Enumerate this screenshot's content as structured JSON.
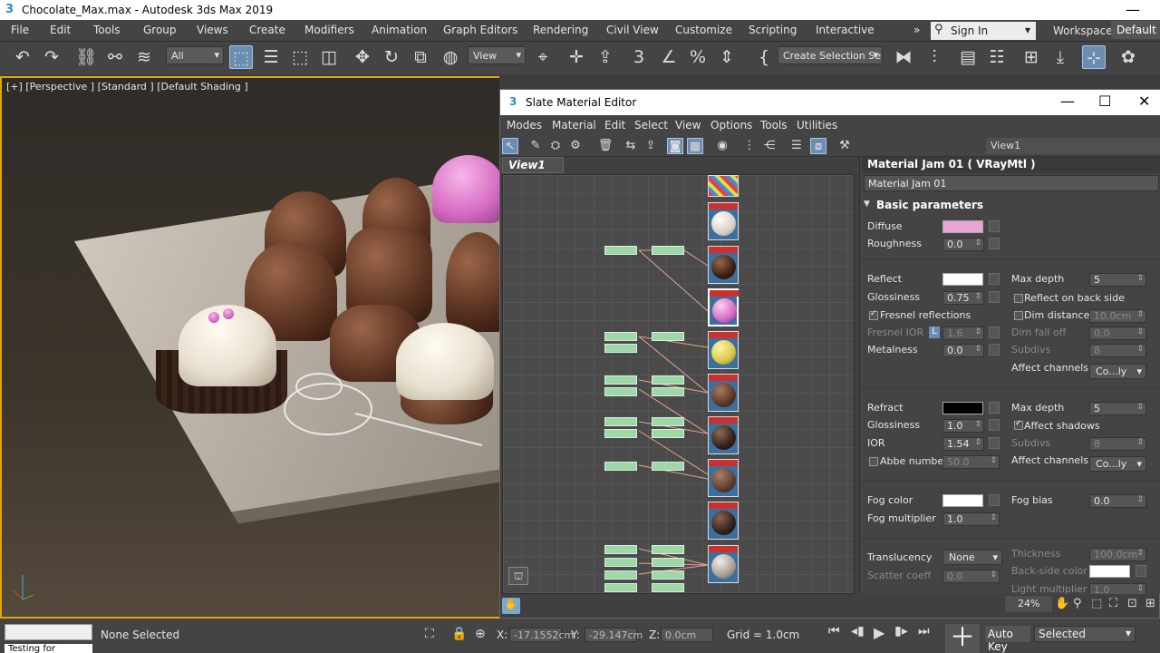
{
  "app": {
    "title": "Chocolate_Max.max - Autodesk 3ds Max 2019",
    "logo_glyph": "3"
  },
  "menu": [
    "File",
    "Edit",
    "Tools",
    "Group",
    "Views",
    "Create",
    "Modifiers",
    "Animation",
    "Graph Editors",
    "Rendering",
    "Civil View",
    "Customize",
    "Scripting",
    "Interactive"
  ],
  "account": {
    "sign_in": "Sign In",
    "workspaces_label": "Workspaces:",
    "workspace": "Default"
  },
  "toolbar": {
    "filter": "All",
    "ref_coord": "View",
    "selection_set": "Create Selection Se"
  },
  "viewport": {
    "label": "[+] [Perspective ] [Standard ] [Default Shading ]"
  },
  "slate": {
    "title": "Slate Material Editor",
    "logo_glyph": "3",
    "menu": [
      "Modes",
      "Material",
      "Edit",
      "Select",
      "View",
      "Options",
      "Tools",
      "Utilities"
    ],
    "view_select": "View1",
    "tab": "View1",
    "zoom": "24%",
    "panel": {
      "header": "Material Jam 01  ( VRayMtl )",
      "name": "Material Jam 01",
      "rollout": "Basic parameters",
      "labels": {
        "diffuse": "Diffuse",
        "roughness": "Roughness",
        "reflect": "Reflect",
        "glossiness": "Glossiness",
        "fresnel": "Fresnel reflections",
        "fresnel_ior": "Fresnel IOR",
        "metalness": "Metalness",
        "max_depth": "Max depth",
        "reflect_back": "Reflect on back side",
        "dim_distance": "Dim distance",
        "dim_falloff": "Dim fall off",
        "subdivs": "Subdivs",
        "affect_channels": "Affect channels",
        "refract": "Refract",
        "refr_gloss": "Glossiness",
        "affect_shadows": "Affect shadows",
        "ior": "IOR",
        "abbe": "Abbe number",
        "fog_color": "Fog color",
        "fog_bias": "Fog bias",
        "fog_multiplier": "Fog multiplier",
        "translucency": "Translucency",
        "thickness": "Thickness",
        "scatter": "Scatter coeff",
        "back_side_color": "Back-side color",
        "light_multiplier": "Light multiplier"
      },
      "values": {
        "roughness": "0.0",
        "glossiness": "0.75",
        "fresnel_ior": "1.6",
        "fresnel_lock": "L",
        "metalness": "0.0",
        "max_depth": "5",
        "dim_distance": "10.0cm",
        "dim_falloff": "0.0",
        "subdivs": "8",
        "affect_channels": "Co...ly",
        "refr_gloss": "1.0",
        "refr_max_depth": "5",
        "ior": "1.54",
        "refr_subdivs": "8",
        "abbe": "50.0",
        "refr_affect_channels": "Co...ly",
        "fog_bias": "0.0",
        "fog_multiplier": "1.0",
        "translucency": "None",
        "thickness": "100.0cm",
        "scatter": "0.0",
        "light_multiplier": "1.0"
      },
      "colors": {
        "diffuse": "#e7a5d3",
        "reflect": "#ffffff",
        "refract": "#000000",
        "fog": "#ffffff",
        "back_side": "#ffffff"
      }
    }
  },
  "status": {
    "selection": "None Selected",
    "x_label": "X:",
    "x": "-17.1552cm",
    "y_label": "Y:",
    "y": "-29.147cm",
    "z_label": "Z:",
    "z": "0.0cm",
    "grid": "Grid = 1.0cm",
    "auto_key": "Auto Key",
    "key_filter": "Selected",
    "listener_text": "Testing for"
  }
}
